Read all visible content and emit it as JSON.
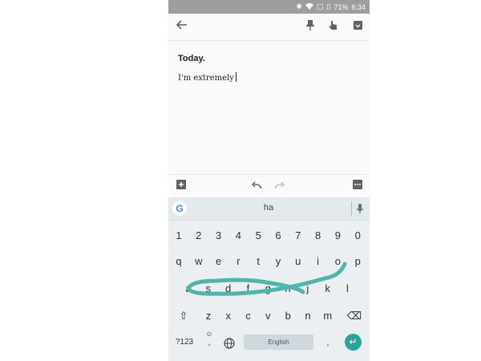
{
  "status": {
    "battery": "71%",
    "time": "6:34"
  },
  "note": {
    "title": "Today.",
    "body": "I'm extremely"
  },
  "keyboard": {
    "suggestion": "ha",
    "google_label": "G",
    "row_numbers": [
      "1",
      "2",
      "3",
      "4",
      "5",
      "6",
      "7",
      "8",
      "9",
      "0"
    ],
    "row_top": [
      "q",
      "w",
      "e",
      "r",
      "t",
      "y",
      "u",
      "i",
      "o",
      "p"
    ],
    "row_middle": [
      "a",
      "s",
      "d",
      "f",
      "g",
      "h",
      "j",
      "k",
      "l"
    ],
    "row_bottom": [
      "z",
      "x",
      "c",
      "v",
      "b",
      "n",
      "m"
    ],
    "symbols_label": "?123",
    "emoji_label": "☺",
    "comma_label": ",",
    "space_label": "English",
    "period_label": ".",
    "shift_glyph": "⇧",
    "backspace_glyph": "⌫",
    "enter_glyph": "↵",
    "globe_glyph": "⊕",
    "swipe_color": "#4db6ac",
    "accent_color": "#26a69a"
  },
  "icons": {
    "back": "arrow-back-icon",
    "pin": "pin-icon",
    "reminder": "touch-reminder-icon",
    "archive": "archive-icon",
    "add": "add-box-icon",
    "undo": "undo-icon",
    "redo": "redo-icon",
    "more": "more-icon",
    "mic": "mic-icon"
  }
}
